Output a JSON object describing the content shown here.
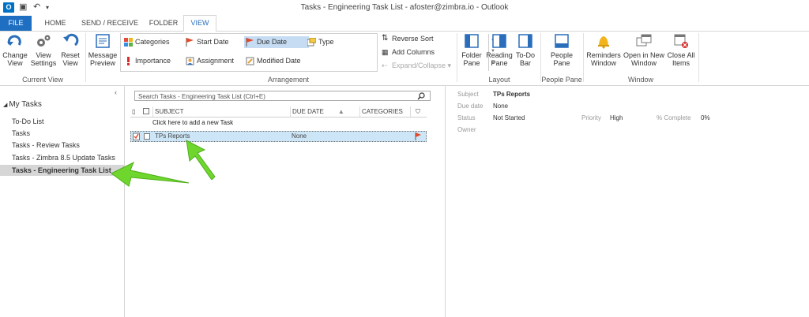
{
  "window": {
    "title": "Tasks - Engineering Task List - afoster@zimbra.io - Outlook"
  },
  "tabs": [
    {
      "label": "FILE"
    },
    {
      "label": "HOME"
    },
    {
      "label": "SEND / RECEIVE"
    },
    {
      "label": "FOLDER"
    },
    {
      "label": "VIEW"
    }
  ],
  "ribbon": {
    "current_view": {
      "change_view": "Change View",
      "view_settings": "View Settings",
      "reset_view": "Reset View",
      "group_label": "Current View"
    },
    "message_preview": "Message Preview",
    "arrangement": {
      "items": [
        "Categories",
        "Importance",
        "Start Date",
        "Assignment",
        "Due Date",
        "Modified Date",
        "Type"
      ],
      "selected": "Due Date",
      "reverse_sort": "Reverse Sort",
      "add_columns": "Add Columns",
      "expand_collapse": "Expand/Collapse",
      "group_label": "Arrangement"
    },
    "layout": {
      "folder_pane": "Folder Pane",
      "reading_pane": "Reading Pane",
      "todo_bar": "To-Do Bar",
      "group_label": "Layout"
    },
    "people_pane": {
      "people_pane": "People Pane",
      "group_label": "People Pane"
    },
    "window": {
      "reminders": "Reminders Window",
      "open_new_window": "Open in New Window",
      "close_all_items": "Close All Items",
      "group_label": "Window"
    }
  },
  "nav": {
    "section": "My Tasks",
    "items": [
      "To-Do List",
      "Tasks",
      "Tasks - Review Tasks",
      "Tasks - Zimbra 8.5 Update Tasks",
      "Tasks - Engineering Task List"
    ],
    "selected": "Tasks - Engineering Task List"
  },
  "search": {
    "placeholder": "Search Tasks - Engineering Task List (Ctrl+E)"
  },
  "grid": {
    "columns": [
      "SUBJECT",
      "DUE DATE",
      "CATEGORIES"
    ],
    "add_new": "Click here to add a new Task",
    "rows": [
      {
        "subject": "TPs Reports",
        "due_date": "None"
      }
    ]
  },
  "reading": {
    "subject_label": "Subject",
    "subject": "TPs Reports",
    "due_label": "Due date",
    "due": "None",
    "status_label": "Status",
    "status": "Not Started",
    "priority_label": "Priority",
    "priority": "High",
    "complete_label": "% Complete",
    "complete": "0%",
    "owner_label": "Owner"
  },
  "colors": {
    "accent": "#1e6ec1",
    "annotation_arrow": "#6fd62e",
    "flag": "#e24a2b"
  }
}
